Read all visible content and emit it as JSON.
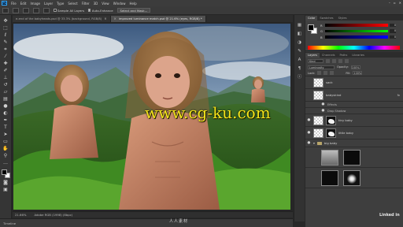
{
  "app": {
    "logo_text": "Ps",
    "menu": [
      "File",
      "Edit",
      "Image",
      "Layer",
      "Type",
      "Select",
      "Filter",
      "3D",
      "View",
      "Window",
      "Help"
    ]
  },
  "options_bar": {
    "sample_all_layers": "Sample All Layers",
    "auto_enhance": "Auto-Enhance",
    "select_and_mask": "Select and Mask..."
  },
  "document_tabs": [
    {
      "title": "e-end of the babyheads.psd @ 33.3% (background, RGB/8)",
      "active": false
    },
    {
      "title": "improved luminance match.psd @ 21.6% (eyes, RGB/8) *",
      "active": true
    }
  ],
  "watermark": "www.cg-ku.com",
  "footer_logo": "人人素材",
  "status_bar": {
    "zoom": "21.66%",
    "profile": "Adobe RGB (1998) (8bpc)"
  },
  "timeline_label": "Timeline",
  "color_panel": {
    "tabs": [
      "Color",
      "Swatches",
      "Styles"
    ],
    "channels": [
      {
        "label": "R",
        "value": "0"
      },
      {
        "label": "G",
        "value": "0"
      },
      {
        "label": "B",
        "value": "0"
      }
    ],
    "colors": {
      "foreground": "#000000",
      "background": "#ffffff"
    }
  },
  "layers_panel": {
    "tabs": [
      "Layers",
      "Channels",
      "Paths",
      "Libraries"
    ],
    "kind_label": "Kind",
    "blend_mode": "Luminosity",
    "opacity_label": "Opacity:",
    "opacity_value": "100%",
    "lock_label": "Lock:",
    "fill_label": "Fill:",
    "fill_value": "100%",
    "layers": [
      {
        "name": "sack"
      },
      {
        "name": "babyskind"
      },
      {
        "name": "Effects",
        "sub": true
      },
      {
        "name": "Drop Shadow",
        "sub": true
      },
      {
        "name": "tiny baby"
      },
      {
        "name": "little baby"
      },
      {
        "name": "big baby",
        "group": true
      }
    ]
  },
  "branding": "Linked in"
}
